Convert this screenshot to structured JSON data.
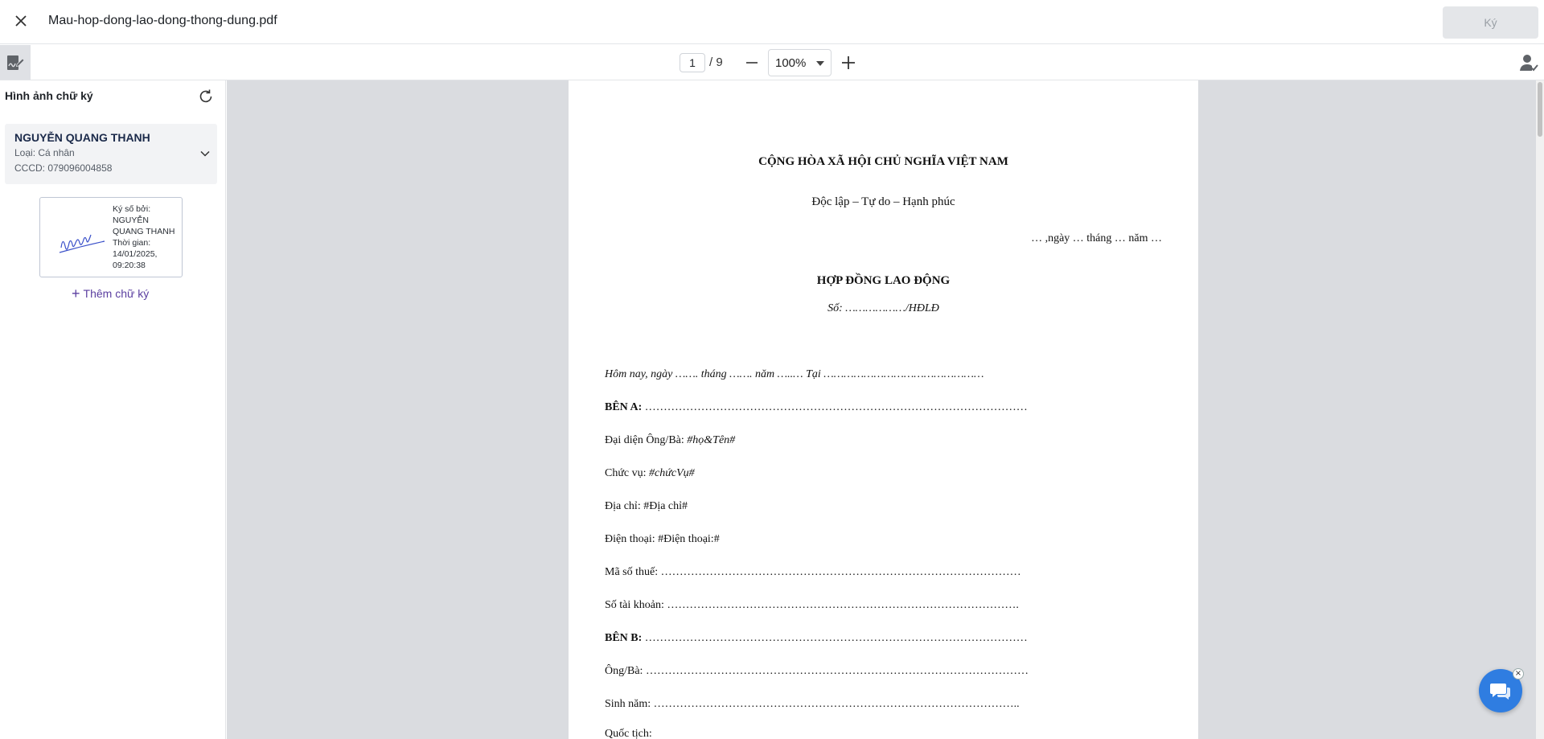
{
  "header": {
    "file_name": "Mau-hop-dong-lao-dong-thong-dung.pdf",
    "sign_label": "Ký",
    "close_icon": "close-icon"
  },
  "toolbar": {
    "current_page": "1",
    "total_pages": "/ 9",
    "zoom": "100%",
    "icons": [
      "signature-panel-icon",
      "minus-icon",
      "chevron-down-icon",
      "plus-icon",
      "user-check-icon"
    ]
  },
  "sidebar": {
    "title": "Hình ảnh chữ ký",
    "signer": {
      "name": "NGUYỄN QUANG THANH",
      "type": "Loại: Cá nhân",
      "id": "CCCD: 079096004858"
    },
    "signature_stamp": {
      "line1": "Ký số bởi:",
      "line2": "NGUYỄN",
      "line3": "QUANG THANH",
      "line4": "Thời gian:",
      "line5": "14/01/2025,",
      "line6": "09:20:38"
    },
    "add_signature": "Thêm chữ ký"
  },
  "document": {
    "heading1": "CỘNG HÒA XÃ HỘI CHỦ NGHĨA VIỆT NAM",
    "heading2": "Độc lập – Tự do – Hạnh phúc",
    "date_line": "… ,ngày … tháng … năm …",
    "contract_title": "HỢP ĐỒNG LAO ĐỘNG",
    "contract_no": "Số: ………………/HĐLĐ",
    "today_line": "Hôm nay, ngày ……. tháng ……. năm …..… Tại …………………………………………",
    "party_a_label": "BÊN A:",
    "party_a_dots": " …………………………………………………………………………………………",
    "rep_label": "Đại diện Ông/Bà: ",
    "rep_value": "#họ&Tên#",
    "position_label": "Chức vụ: ",
    "position_value": "#chứcVụ#",
    "address_line": "Địa chỉ: #Địa chỉ#",
    "phone_line": "Điện thoại: #Điện thoại:#",
    "tax_line": "Mã số thuế: ……………………………………………………………………………………",
    "account_line": "Số tài khoản: ………………………………………………………………………………….",
    "party_b_label": "BÊN B:",
    "party_b_dots": " …………………………………………………………………………………………",
    "name_line": "Ông/Bà: …………………………………………………………………………………………",
    "birth_line": "Sinh năm: ……………………………………………………………………………………..",
    "nationality_line": "Quốc tịch:"
  }
}
